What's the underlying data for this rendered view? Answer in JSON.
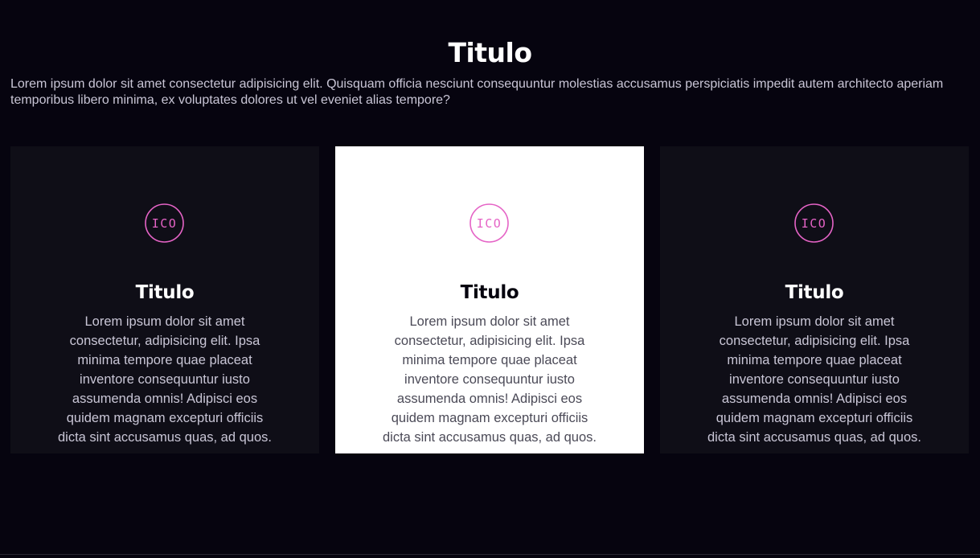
{
  "section": {
    "title": "Titulo",
    "description": "Lorem ipsum dolor sit amet consectetur adipisicing elit. Quisquam officia nesciunt consequuntur molestias accusamus perspiciatis impedit autem architecto aperiam temporibus libero minima, ex voluptates dolores ut vel eveniet alias tempore?"
  },
  "colors": {
    "background": "#06040f",
    "card_dark": "#0f0e17",
    "card_light": "#ffffff",
    "icon_accent": "#e563c6"
  },
  "cards": [
    {
      "icon": "ico-badge-icon",
      "icon_text": "ICO",
      "title": "Titulo",
      "text": "Lorem ipsum dolor sit amet consectetur, adipisicing elit. Ipsa minima tempore quae placeat inventore consequuntur iusto assumenda omnis! Adipisci eos quidem magnam excepturi officiis dicta sint accusamus quas, ad quos."
    },
    {
      "icon": "ico-badge-icon",
      "icon_text": "ICO",
      "title": "Titulo",
      "text": "Lorem ipsum dolor sit amet consectetur, adipisicing elit. Ipsa minima tempore quae placeat inventore consequuntur iusto assumenda omnis! Adipisci eos quidem magnam excepturi officiis dicta sint accusamus quas, ad quos."
    },
    {
      "icon": "ico-badge-icon",
      "icon_text": "ICO",
      "title": "Titulo",
      "text": "Lorem ipsum dolor sit amet consectetur, adipisicing elit. Ipsa minima tempore quae placeat inventore consequuntur iusto assumenda omnis! Adipisci eos quidem magnam excepturi officiis dicta sint accusamus quas, ad quos."
    }
  ]
}
